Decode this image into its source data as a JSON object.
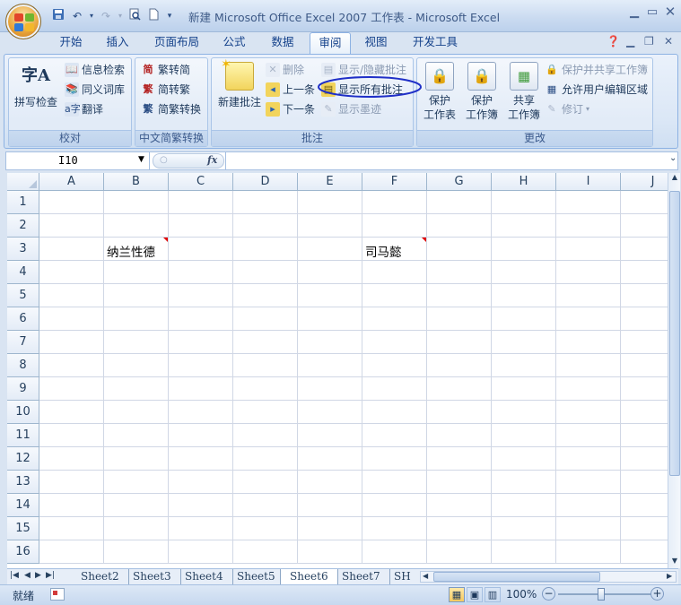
{
  "window": {
    "title": "新建 Microsoft Office Excel 2007 工作表 - Microsoft Excel"
  },
  "qat": {
    "save_icon": "save-icon",
    "undo_icon": "undo-icon",
    "redo_icon": "redo-icon",
    "print_preview_icon": "print-preview-icon",
    "new_icon": "new-file-icon"
  },
  "tabs": [
    {
      "label": "开始"
    },
    {
      "label": "插入"
    },
    {
      "label": "页面布局"
    },
    {
      "label": "公式"
    },
    {
      "label": "数据"
    },
    {
      "label": "审阅",
      "active": true
    },
    {
      "label": "视图"
    },
    {
      "label": "开发工具"
    }
  ],
  "ribbon": {
    "proofing": {
      "label": "校对",
      "spell_check": "拼写检查",
      "research": "信息检索",
      "thesaurus": "同义词库",
      "translate": "翻译"
    },
    "chinese_conversion": {
      "label": "中文简繁转换",
      "to_simplified": "繁转简",
      "to_traditional": "简转繁",
      "convert": "简繁转换"
    },
    "comments": {
      "label": "批注",
      "new_comment": "新建批注",
      "delete": "删除",
      "previous": "上一条",
      "next": "下一条",
      "show_hide": "显示/隐藏批注",
      "show_all": "显示所有批注",
      "show_ink": "显示墨迹"
    },
    "changes": {
      "label": "更改",
      "protect_sheet_1": "保护",
      "protect_sheet_2": "工作表",
      "protect_workbook_1": "保护",
      "protect_workbook_2": "工作簿",
      "share_workbook_1": "共享",
      "share_workbook_2": "工作簿",
      "protect_and_share": "保护并共享工作簿",
      "allow_edit_ranges": "允许用户编辑区域",
      "track_changes": "修订"
    }
  },
  "formula_bar": {
    "name_box": "I10",
    "fx": "fx",
    "formula": ""
  },
  "grid": {
    "columns": [
      "A",
      "B",
      "C",
      "D",
      "E",
      "F",
      "G",
      "H",
      "I",
      "J"
    ],
    "rows": [
      "1",
      "2",
      "3",
      "4",
      "5",
      "6",
      "7",
      "8",
      "9",
      "10",
      "11",
      "12",
      "13",
      "14",
      "15",
      "16"
    ],
    "cells": [
      {
        "ref": "B3",
        "text": "纳兰性德",
        "has_comment": true
      },
      {
        "ref": "F3",
        "text": "司马懿",
        "has_comment": true
      }
    ]
  },
  "sheet_tabs": [
    "Sheet2",
    "Sheet3",
    "Sheet4",
    "Sheet5",
    "Sheet6",
    "Sheet7",
    "SH"
  ],
  "active_sheet": "Sheet6",
  "status": {
    "ready": "就绪",
    "zoom": "100%"
  },
  "colors": {
    "annotation_ellipse": "#1f2fc7",
    "comment_indicator": "#e00000"
  }
}
